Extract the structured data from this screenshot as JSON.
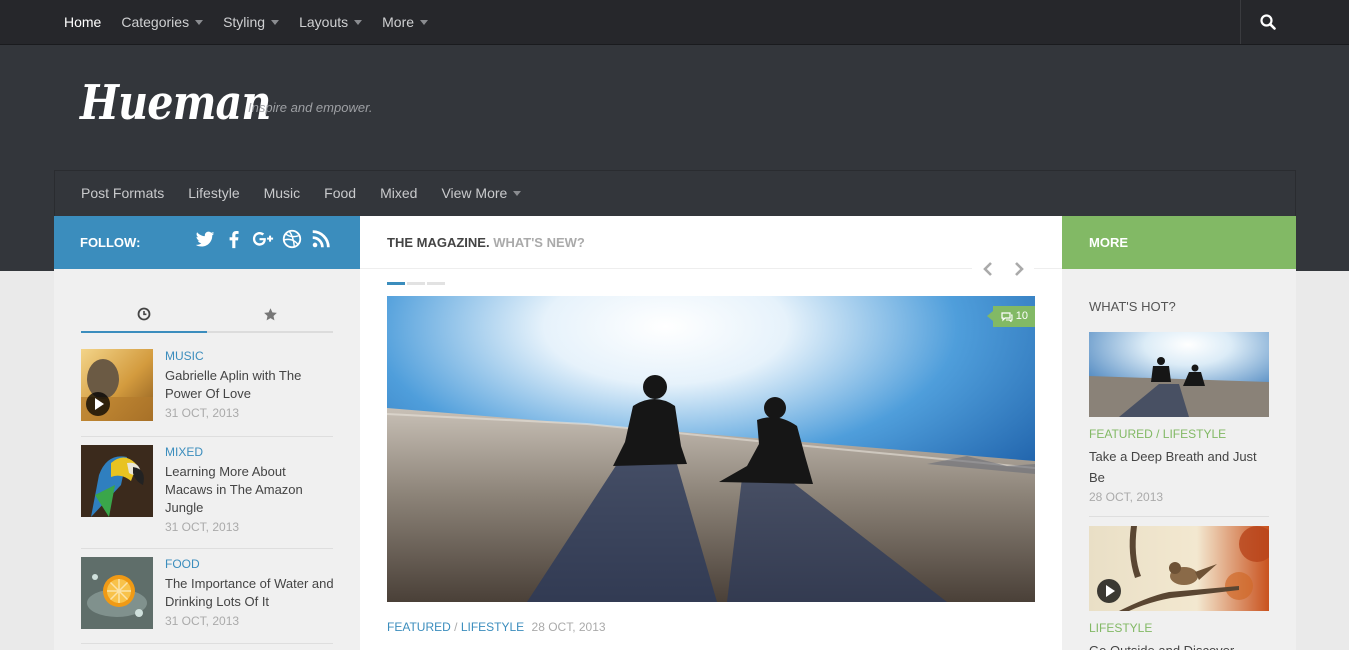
{
  "topnav": {
    "items": [
      {
        "label": "Home"
      },
      {
        "label": "Categories"
      },
      {
        "label": "Styling"
      },
      {
        "label": "Layouts"
      },
      {
        "label": "More"
      }
    ]
  },
  "header": {
    "logo": "Hueman",
    "tagline": "Inspire and empower."
  },
  "mainnav": {
    "items": [
      {
        "label": "Post Formats"
      },
      {
        "label": "Lifestyle"
      },
      {
        "label": "Music"
      },
      {
        "label": "Food"
      },
      {
        "label": "Mixed"
      },
      {
        "label": "View More"
      }
    ]
  },
  "sidebar_left": {
    "follow_label": "FOLLOW:",
    "social_icons": [
      "twitter-icon",
      "facebook-icon",
      "google-plus-icon",
      "dribbble-icon",
      "rss-icon"
    ],
    "tab_icons": [
      "clock-icon",
      "star-icon"
    ],
    "posts": [
      {
        "category": "MUSIC",
        "title": "Gabrielle Aplin with The Power Of Love",
        "date": "31 OCT, 2013"
      },
      {
        "category": "MIXED",
        "title": "Learning More About Macaws in The Amazon Jungle",
        "date": "31 OCT, 2013"
      },
      {
        "category": "FOOD",
        "title": "The Importance of Water and Drinking Lots Of It",
        "date": "31 OCT, 2013"
      }
    ]
  },
  "main": {
    "heading": "THE MAGAZINE.",
    "subheading": "WHAT'S NEW?",
    "comment_count": "10",
    "featured": {
      "category1": "FEATURED",
      "separator": "/",
      "category2": "LIFESTYLE",
      "date": "28 OCT, 2013"
    }
  },
  "sidebar_right": {
    "more_label": "MORE",
    "hot_heading": "WHAT'S HOT?",
    "posts": [
      {
        "category": "FEATURED / LIFESTYLE",
        "title": "Take a Deep Breath and Just Be",
        "date": "28 OCT, 2013"
      },
      {
        "category": "LIFESTYLE",
        "title": "Go Outside and Discover"
      }
    ]
  },
  "colors": {
    "accent_blue": "#3b8dbd",
    "accent_green": "#82b965",
    "topbar": "#26272b",
    "header": "#33363b"
  }
}
